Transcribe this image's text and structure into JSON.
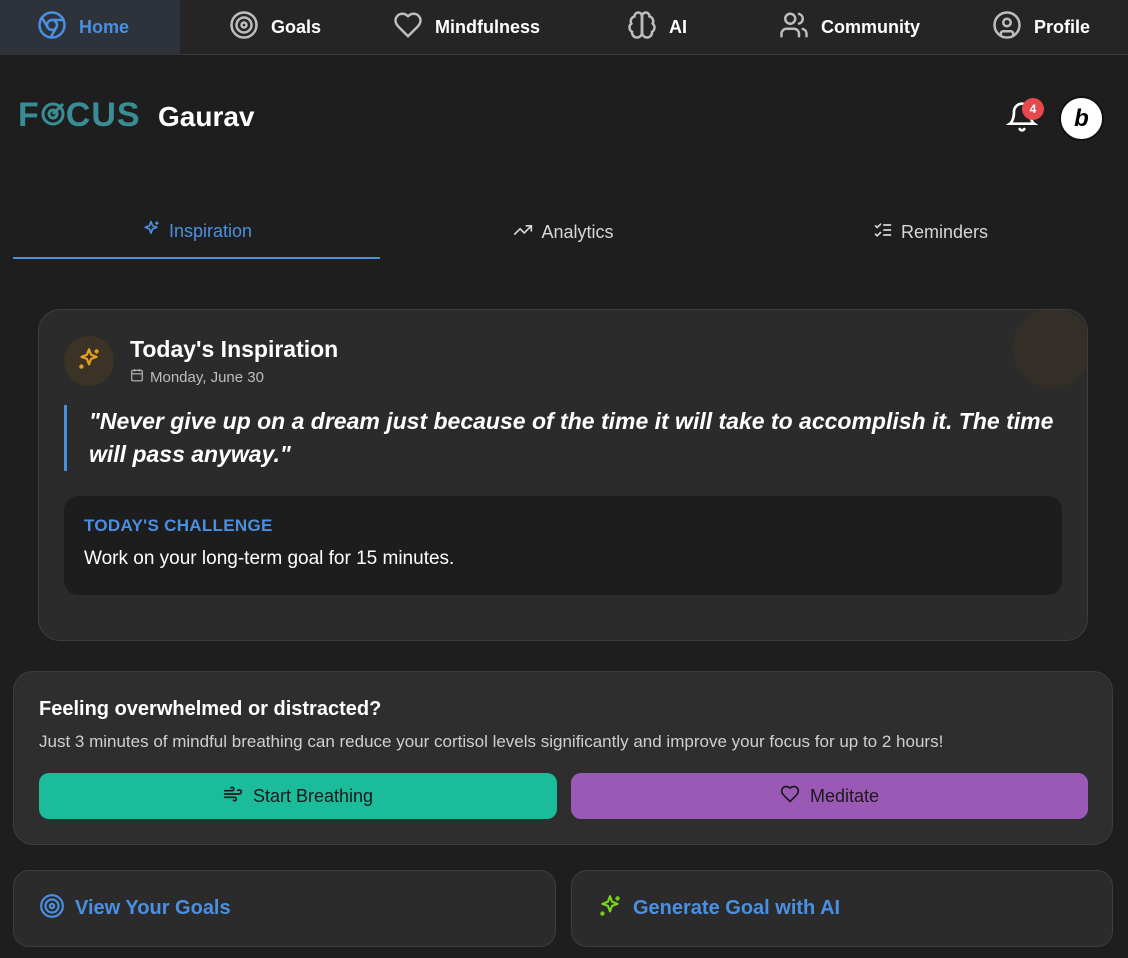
{
  "nav": {
    "items": [
      {
        "label": "Home",
        "icon": "chrome-icon",
        "active": true
      },
      {
        "label": "Goals",
        "icon": "target-icon"
      },
      {
        "label": "Mindfulness",
        "icon": "heart-icon"
      },
      {
        "label": "AI",
        "icon": "brain-icon"
      },
      {
        "label": "Community",
        "icon": "users-icon"
      },
      {
        "label": "Profile",
        "icon": "user-circle-icon"
      }
    ]
  },
  "header": {
    "logo_prefix": "F",
    "logo_suffix": "CUS",
    "username": "Gaurav",
    "notification_count": "4",
    "bolt_badge": "b"
  },
  "tabs": [
    {
      "label": "Inspiration",
      "icon": "sparkle-icon",
      "active": true
    },
    {
      "label": "Analytics",
      "icon": "trending-up-icon"
    },
    {
      "label": "Reminders",
      "icon": "list-checks-icon"
    }
  ],
  "inspiration": {
    "title": "Today's Inspiration",
    "date": "Monday, June 30",
    "quote": "\"Never give up on a dream just because of the time it will take to accomplish it. The time will pass anyway.\"",
    "challenge_label": "TODAY'S CHALLENGE",
    "challenge_text": "Work on your long-term goal for 15 minutes."
  },
  "breathing": {
    "title": "Feeling overwhelmed or distracted?",
    "description": "Just 3 minutes of mindful breathing can reduce your cortisol levels significantly and improve your focus for up to 2 hours!",
    "start_label": "Start Breathing",
    "meditate_label": "Meditate"
  },
  "actions": {
    "goals_label": "View Your Goals",
    "ai_label": "Generate Goal with AI"
  },
  "colors": {
    "accent": "#4a90e2",
    "teal": "#1abc9c",
    "purple": "#9b59b6",
    "logo": "#3a8d95",
    "badge": "#e5484d",
    "sparkle": "#f0a020",
    "ai_sparkle": "#7ed321"
  }
}
